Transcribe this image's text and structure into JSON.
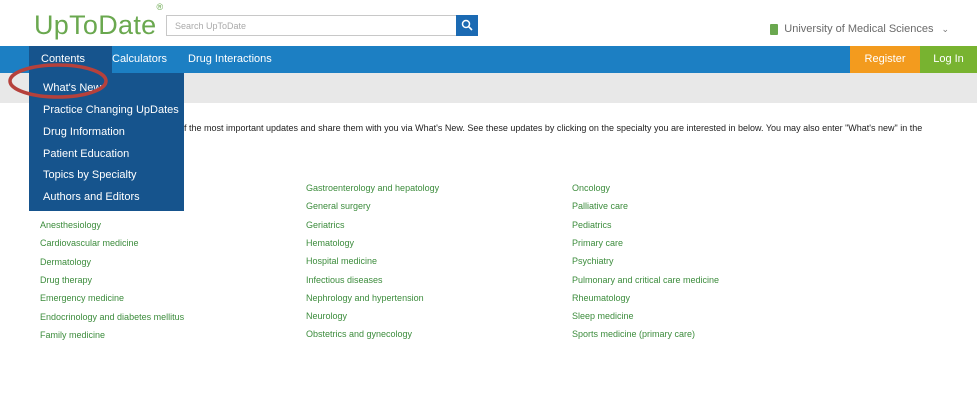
{
  "header": {
    "logo": "UpToDate",
    "logo_mark": "®",
    "search_placeholder": "Search UpToDate",
    "institution": "University of Medical Sciences"
  },
  "nav": {
    "contents": "Contents",
    "calculators": "Calculators",
    "drug_interactions": "Drug Interactions",
    "register": "Register",
    "login": "Log In"
  },
  "dropdown": {
    "items": [
      "What's New",
      "Practice Changing UpDates",
      "Drug Information",
      "Patient Education",
      "Topics by Specialty",
      "Authors and Editors"
    ]
  },
  "intro": "f the most important updates and share them with you via What's New. See these updates by clicking on the specialty you are interested in below. You may also enter \"What's new\" in the",
  "specialties": {
    "col1": [
      "Anesthesiology",
      "Cardiovascular medicine",
      "Dermatology",
      "Drug therapy",
      "Emergency medicine",
      "Endocrinology and diabetes mellitus",
      "Family medicine"
    ],
    "col2": [
      "Gastroenterology and hepatology",
      "General surgery",
      "Geriatrics",
      "Hematology",
      "Hospital medicine",
      "Infectious diseases",
      "Nephrology and hypertension",
      "Neurology",
      "Obstetrics and gynecology"
    ],
    "col3": [
      "Oncology",
      "Palliative care",
      "Pediatrics",
      "Primary care",
      "Psychiatry",
      "Pulmonary and critical care medicine",
      "Rheumatology",
      "Sleep medicine",
      "Sports medicine (primary care)"
    ]
  },
  "colors": {
    "brand_green": "#6aa84f",
    "nav_blue": "#1c7fc3",
    "dropdown_blue": "#16548d",
    "register_orange": "#f39b1e",
    "login_green": "#78b330",
    "highlight_red": "#b5413c"
  }
}
